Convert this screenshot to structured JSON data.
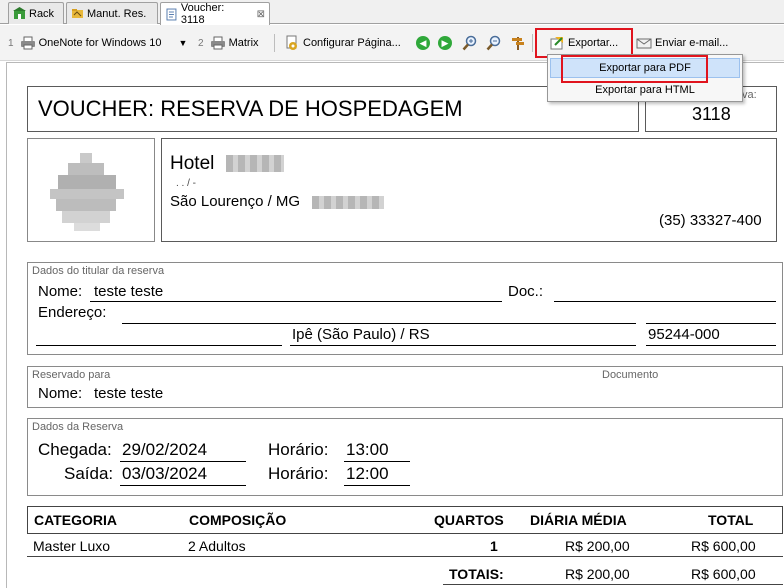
{
  "tabs": [
    {
      "label": "Rack"
    },
    {
      "label": "Manut. Res."
    },
    {
      "label": "Voucher: 3118"
    }
  ],
  "toolbar": {
    "printer1_num": "1",
    "printer1_label": "OneNote for Windows 10",
    "printer2_num": "2",
    "printer2_label": "Matrix",
    "config_label": "Configurar Página...",
    "export_label": "Exportar...",
    "email_label": "Enviar e-mail..."
  },
  "export_menu": {
    "items": [
      {
        "label": "Exportar para PDF"
      },
      {
        "label": "Exportar para HTML"
      }
    ]
  },
  "voucher": {
    "title": "VOUCHER:  RESERVA DE HOSPEDAGEM",
    "number_label_partial": "va:",
    "number": "3118"
  },
  "hotel": {
    "name_prefix": "Hotel",
    "address_partial": ". . /  -",
    "city": "São Lourenço / MG",
    "phone": "(35) 33327-400"
  },
  "holder": {
    "section_title": "Dados do titular da reserva",
    "name_label": "Nome:",
    "name_value": "teste teste",
    "doc_label": "Doc.:",
    "address_label": "Endereço:",
    "city_value": "Ipê (São Paulo) / RS",
    "zip_value": "95244-000"
  },
  "reserved_for": {
    "section_title": "Reservado para",
    "document_label": "Documento",
    "name_label": "Nome:",
    "name_value": "teste teste"
  },
  "reservation": {
    "section_title": "Dados da Reserva",
    "checkin_label": "Chegada:",
    "checkin_date": "29/02/2024",
    "checkin_time_label": "Horário:",
    "checkin_time": "13:00",
    "checkout_label": "Saída:",
    "checkout_date": "03/03/2024",
    "checkout_time_label": "Horário:",
    "checkout_time": "12:00"
  },
  "table": {
    "headers": {
      "categoria": "CATEGORIA",
      "composicao": "COMPOSIÇÃO",
      "quartos": "QUARTOS",
      "diaria": "DIÁRIA MÉDIA",
      "total": "TOTAL"
    },
    "rows": [
      {
        "categoria": "Master Luxo",
        "composicao": "2 Adultos",
        "quartos": "1",
        "diaria": "R$ 200,00",
        "total": "R$ 600,00"
      }
    ],
    "totals_label": "TOTAIS:",
    "totals_diaria": "R$ 200,00",
    "totals_total": "R$ 600,00"
  },
  "colors": {
    "highlight": "#e0141e",
    "menu_selected": "#cfe3fa"
  }
}
